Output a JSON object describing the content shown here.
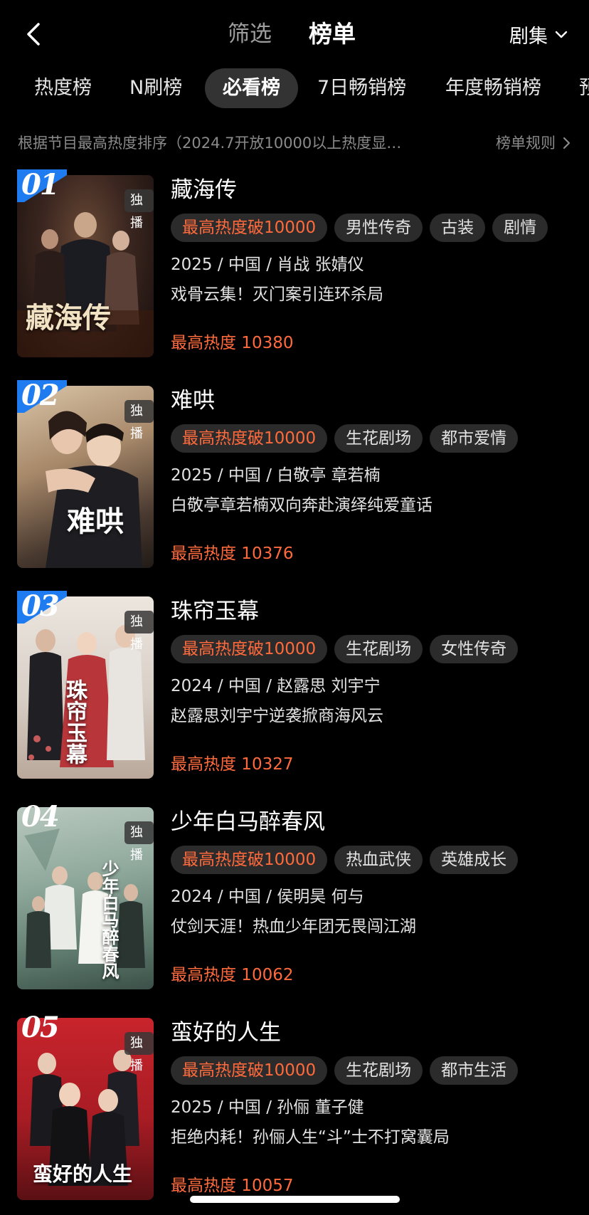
{
  "header": {
    "back_icon": "chevron-left-icon",
    "tab_filter": "筛选",
    "tab_ranking": "榜单",
    "category": "剧集",
    "category_icon": "chevron-down-icon"
  },
  "rank_tabs": {
    "items": [
      {
        "label": "热度榜"
      },
      {
        "label": "N刷榜"
      },
      {
        "label": "必看榜",
        "selected": true
      },
      {
        "label": "7日畅销榜"
      },
      {
        "label": "年度畅销榜"
      },
      {
        "label": "预"
      }
    ]
  },
  "rule": {
    "description": "根据节目最高热度排序（2024.7开放10000以上热度显…",
    "link": "榜单规则",
    "link_icon": "chevron-right-icon"
  },
  "list": {
    "items": [
      {
        "rank": "01",
        "exclusive": "独播",
        "poster_title": "藏海传",
        "title": "藏海传",
        "tags": [
          "最高热度破10000",
          "男性传奇",
          "古装",
          "剧情"
        ],
        "meta": "2025 / 中国 / 肖战 张婧仪",
        "desc": "戏骨云集！灭门案引连环杀局",
        "heat": "最高热度 10380"
      },
      {
        "rank": "02",
        "exclusive": "独播",
        "poster_title": "难哄",
        "title": "难哄",
        "tags": [
          "最高热度破10000",
          "生花剧场",
          "都市爱情"
        ],
        "meta": "2025 / 中国 / 白敬亭 章若楠",
        "desc": "白敬亭章若楠双向奔赴演绎纯爱童话",
        "heat": "最高热度 10376"
      },
      {
        "rank": "03",
        "exclusive": "独播",
        "poster_title": "珠帘玉幕",
        "title": "珠帘玉幕",
        "tags": [
          "最高热度破10000",
          "生花剧场",
          "女性传奇"
        ],
        "meta": "2024 / 中国 / 赵露思 刘宇宁",
        "desc": "赵露思刘宇宁逆袭掀商海风云",
        "heat": "最高热度 10327"
      },
      {
        "rank": "04",
        "exclusive": "独播",
        "poster_title": "少年白马醉春风",
        "title": "少年白马醉春风",
        "tags": [
          "最高热度破10000",
          "热血武侠",
          "英雄成长"
        ],
        "meta": "2024 / 中国 / 侯明昊 何与",
        "desc": "仗剑天涯！热血少年团无畏闯江湖",
        "heat": "最高热度 10062"
      },
      {
        "rank": "05",
        "exclusive": "独播",
        "poster_title": "蛮好的人生",
        "title": "蛮好的人生",
        "tags": [
          "最高热度破10000",
          "生花剧场",
          "都市生活"
        ],
        "meta": "2025 / 中国 / 孙俪 董子健",
        "desc": "拒绝内耗！孙俪人生“斗”士不打窝囊局",
        "heat": "最高热度 10057"
      }
    ]
  },
  "colors": {
    "background": "#000000",
    "accent_heat": "#ff6a3d",
    "tag_bg": "#2b2b2b",
    "selected_tab_bg": "#333333",
    "rank_badge_top3": "#1e7cf0"
  }
}
